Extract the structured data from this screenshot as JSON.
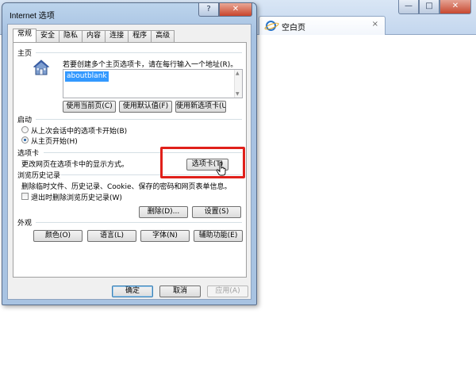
{
  "browser": {
    "tab_title": "空白页",
    "tab_close": "×",
    "caption": {
      "minimize": "—",
      "maximize": "□",
      "close": "✕"
    }
  },
  "dialog": {
    "title": "Internet 选项",
    "help_button": "?",
    "close_button": "✕",
    "tabs": [
      "常规",
      "安全",
      "隐私",
      "内容",
      "连接",
      "程序",
      "高级"
    ],
    "active_tab": "常规",
    "home": {
      "group": "主页",
      "instruction": "若要创建多个主页选项卡，请在每行输入一个地址(R)。",
      "url": "aboutblank",
      "buttons": {
        "use_current": "使用当前页(C)",
        "use_default": "使用默认值(F)",
        "use_new_tab": "使用新选项卡(U)"
      }
    },
    "startup": {
      "group": "启动",
      "option_last_session": "从上次会话中的选项卡开始(B)",
      "option_home": "从主页开始(H)",
      "selected": "option_home"
    },
    "tabs_section": {
      "group": "选项卡",
      "description": "更改网页在选项卡中的显示方式。",
      "button": "选项卡(T)"
    },
    "history": {
      "group": "浏览历史记录",
      "description": "删除临时文件、历史记录、Cookie、保存的密码和网页表单信息。",
      "delete_on_exit": "退出时删除浏览历史记录(W)",
      "delete_on_exit_checked": false,
      "delete_button": "删除(D)...",
      "settings_button": "设置(S)"
    },
    "appearance": {
      "group": "外观",
      "colors": "颜色(O)",
      "languages": "语言(L)",
      "fonts": "字体(N)",
      "accessibility": "辅助功能(E)"
    },
    "footer": {
      "ok": "确定",
      "cancel": "取消",
      "apply": "应用(A)"
    }
  },
  "colors": {
    "highlight": "#e0201a",
    "selection": "#3399ff"
  }
}
